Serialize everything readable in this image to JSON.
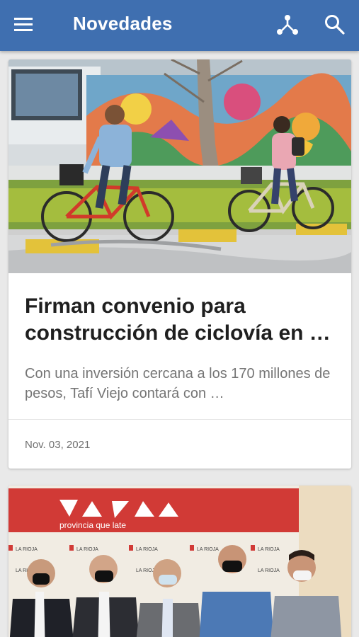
{
  "app_bar": {
    "title": "Novedades",
    "icons": {
      "menu": "menu-icon",
      "share": "share-icon",
      "search": "search-icon"
    },
    "color": "#3f6fb0"
  },
  "articles": [
    {
      "image": "cyclists-mural-photo",
      "title": "Firman convenio para construcción de ciclovía en …",
      "excerpt": "Con una inversión cercana a los 170 millones de pesos, Tafí Viejo contará con …",
      "date": "Nov. 03, 2021"
    },
    {
      "image": "officials-group-photo",
      "banner_logo_text": "LA RIOJA",
      "banner_tagline": "provincia que late",
      "backdrop_repeat_text": "LA RIOJA"
    }
  ]
}
